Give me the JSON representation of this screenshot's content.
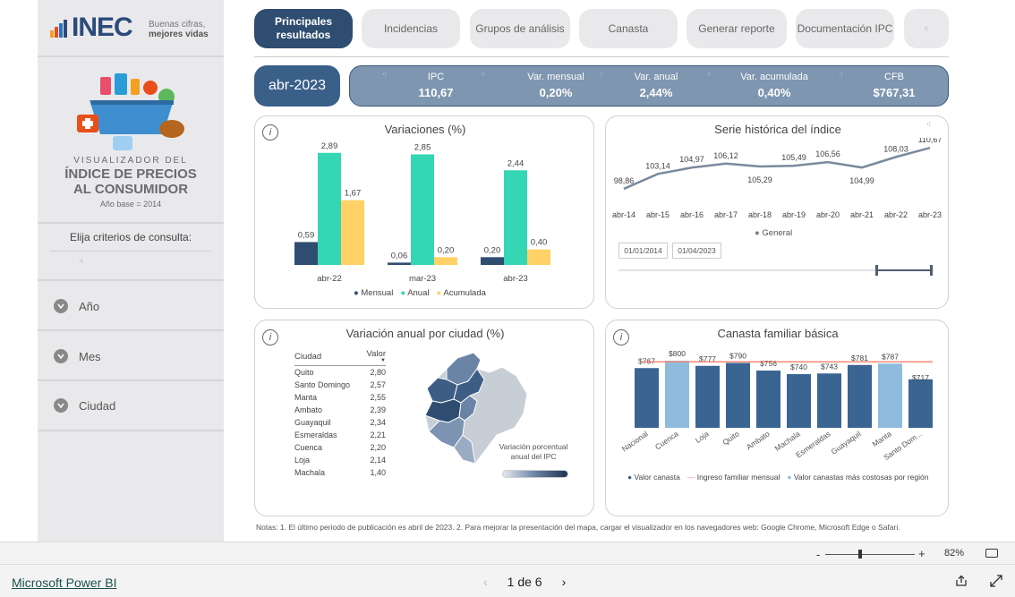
{
  "logo": {
    "brand": "INEC",
    "tagline1": "Buenas cifras,",
    "tagline2": "mejores vidas"
  },
  "sidebar": {
    "title1": "VISUALIZADOR DEL",
    "title2": "ÍNDICE DE PRECIOS",
    "title3": "AL CONSUMIDOR",
    "base": "Año base = 2014",
    "criteria": "Elija criterios de consulta:",
    "filters": [
      {
        "label": "Año"
      },
      {
        "label": "Mes"
      },
      {
        "label": "Ciudad"
      }
    ]
  },
  "tabs": [
    {
      "label": "Principales resultados"
    },
    {
      "label": "Incidencias"
    },
    {
      "label": "Grupos de análisis"
    },
    {
      "label": "Canasta"
    },
    {
      "label": "Generar reporte"
    },
    {
      "label": "Documentación IPC"
    }
  ],
  "period": "abr-2023",
  "kpis": [
    {
      "label": "IPC",
      "value": "110,67"
    },
    {
      "label": "Var. mensual",
      "value": "0,20%"
    },
    {
      "label": "Var. anual",
      "value": "2,44%"
    },
    {
      "label": "Var. acumulada",
      "value": "0,40%"
    },
    {
      "label": "CFB",
      "value": "$767,31"
    }
  ],
  "variaciones": {
    "title": "Variaciones (%)",
    "legend": [
      "Mensual",
      "Anual",
      "Acumulada"
    ],
    "colors": [
      "#2f4d70",
      "#35d6b3",
      "#ffd166"
    ]
  },
  "serie": {
    "title": "Serie histórica del índice",
    "legend": "General",
    "date_from": "01/01/2014",
    "date_to": "01/04/2023"
  },
  "ciudad": {
    "title": "Variación anual por ciudad (%)",
    "col_city": "Ciudad",
    "col_value": "Valor",
    "rows": [
      {
        "city": "Quito",
        "value": "2,80"
      },
      {
        "city": "Santo Domingo",
        "value": "2,57"
      },
      {
        "city": "Manta",
        "value": "2,55"
      },
      {
        "city": "Ambato",
        "value": "2,39"
      },
      {
        "city": "Guayaquil",
        "value": "2,34"
      },
      {
        "city": "Esmeraldas",
        "value": "2,21"
      },
      {
        "city": "Cuenca",
        "value": "2,20"
      },
      {
        "city": "Loja",
        "value": "2,14"
      },
      {
        "city": "Machala",
        "value": "1,40"
      }
    ],
    "map_legend1": "Variación porcentual",
    "map_legend2": "anual del IPC"
  },
  "canasta": {
    "title": "Canasta familiar básica",
    "legend": [
      "Valor canasta",
      "Ingreso familiar mensual",
      "Valor canastas más costosas por región"
    ]
  },
  "chart_data": [
    {
      "type": "bar",
      "title": "Variaciones (%)",
      "categories": [
        "abr-22",
        "mar-23",
        "abr-23"
      ],
      "series": [
        {
          "name": "Mensual",
          "values": [
            0.59,
            0.06,
            0.2
          ],
          "labels": [
            "0,59",
            "0,06",
            "0,20"
          ]
        },
        {
          "name": "Anual",
          "values": [
            2.89,
            2.85,
            2.44
          ],
          "labels": [
            "2,89",
            "2,85",
            "2,44"
          ]
        },
        {
          "name": "Acumulada",
          "values": [
            1.67,
            0.2,
            0.4
          ],
          "labels": [
            "1,67",
            "0,20",
            "0,40"
          ]
        }
      ]
    },
    {
      "type": "line",
      "title": "Serie histórica del índice",
      "x": [
        "abr-14",
        "abr-15",
        "abr-16",
        "abr-17",
        "abr-18",
        "abr-19",
        "abr-20",
        "abr-21",
        "abr-22",
        "abr-23"
      ],
      "series": [
        {
          "name": "General",
          "values": [
            98.86,
            103.14,
            104.97,
            106.12,
            105.29,
            105.49,
            106.56,
            104.99,
            108.03,
            110.67
          ],
          "labels": [
            "98,86",
            "103,14",
            "104,97",
            "106,12",
            "105,29",
            "105,49",
            "106,56",
            "104,99",
            "108,03",
            "110,67"
          ]
        }
      ]
    },
    {
      "type": "bar",
      "title": "Canasta familiar básica",
      "categories": [
        "Nacional",
        "Cuenca",
        "Loja",
        "Quito",
        "Ambato",
        "Machala",
        "Esmeraldas",
        "Guayaquil",
        "Manta",
        "Santo Dom..."
      ],
      "series": [
        {
          "name": "Valor canasta",
          "values": [
            767,
            800,
            777,
            790,
            756,
            740,
            743,
            781,
            787,
            717
          ],
          "labels": [
            "$767",
            "$800",
            "$777",
            "$790",
            "$756",
            "$740",
            "$743",
            "$781",
            "$787",
            "$717"
          ],
          "highlight": [
            false,
            true,
            false,
            false,
            false,
            false,
            false,
            false,
            true,
            false
          ]
        },
        {
          "name": "Ingreso familiar mensual",
          "values": [
            795,
            795,
            795,
            795,
            795,
            795,
            795,
            795,
            795,
            795
          ]
        }
      ]
    }
  ],
  "notes": "Notas:  1. El último periodo de publicación es abril de 2023.  2. Para mejorar la presentación del mapa, cargar el visualizador en los navegadores web: Google Chrome, Microsoft Edge o Safari.",
  "bottom": {
    "app": "Microsoft Power BI",
    "page": "1 de 6",
    "zoom": "82%"
  }
}
